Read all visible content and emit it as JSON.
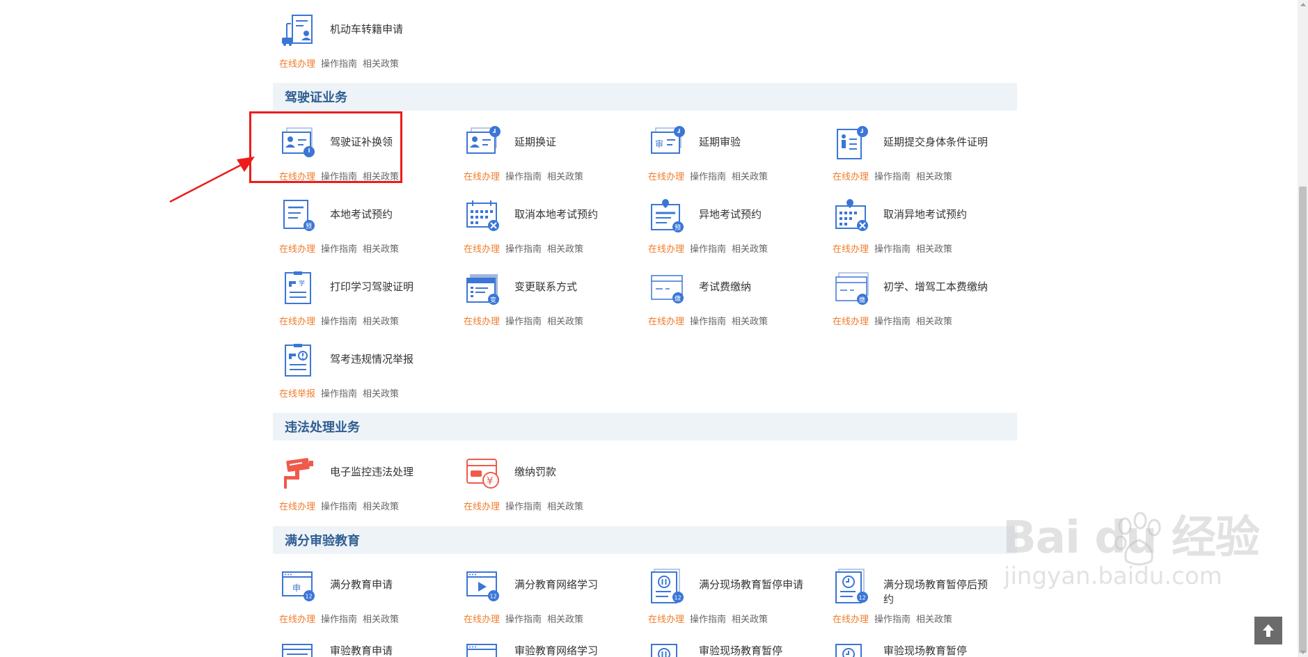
{
  "links": {
    "online": "在线办理",
    "report": "在线举报",
    "guide": "操作指南",
    "policy": "相关政策"
  },
  "sections": [
    {
      "title": "驾驶证业务"
    },
    {
      "title": "违法处理业务"
    },
    {
      "title": "满分审验教育"
    }
  ],
  "items": {
    "vehicle_transfer": "机动车转籍申请",
    "license_replace": "驾驶证补换领",
    "delay_renew": "延期换证",
    "delay_inspect": "延期审验",
    "delay_health": "延期提交身体条件证明",
    "local_exam": "本地考试预约",
    "cancel_local_exam": "取消本地考试预约",
    "remote_exam": "异地考试预约",
    "cancel_remote_exam": "取消异地考试预约",
    "print_learning": "打印学习驾驶证明",
    "change_contact": "变更联系方式",
    "exam_fee": "考试费缴纳",
    "first_fee": "初学、增驾工本费缴纳",
    "exam_violation": "驾考违规情况举报",
    "camera_violation": "电子监控违法处理",
    "pay_fine": "缴纳罚款",
    "full_edu_apply": "满分教育申请",
    "full_edu_online": "满分教育网络学习",
    "full_onsite_pause": "满分现场教育暂停申请",
    "full_onsite_after": "满分现场教育暂停后预约",
    "audit_edu_apply": "审验教育申请",
    "audit_edu_online": "审验教育网络学习",
    "audit_onsite_pause": "审验现场教育暂停",
    "audit_onsite_after": "审验现场教育暂停"
  },
  "icon_text": {
    "pre": "预",
    "change": "变",
    "pay": "缴",
    "study": "学",
    "audit": "审",
    "apply": "申",
    "twelve": "12",
    "yuan": "¥"
  },
  "watermark": {
    "brand": "Bai du 经验",
    "url": "jingyan.baidu.com"
  },
  "colors": {
    "accent_blue": "#3b76d6",
    "online_orange": "#f07c2b",
    "section_title": "#2f5d91",
    "section_bg": "#eef3f8",
    "highlight_red": "#ee1b1b",
    "violation_red": "#f05a4a"
  }
}
